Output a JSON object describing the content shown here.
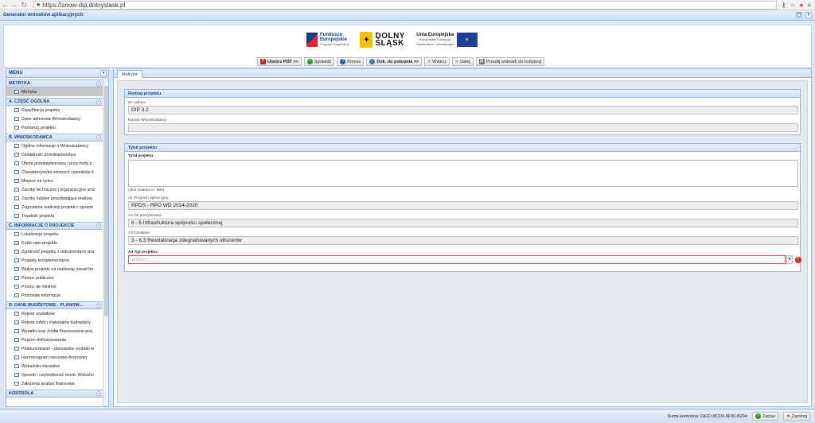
{
  "browser": {
    "url": "https://snow-dip.dolnyslask.pl"
  },
  "app": {
    "title": "Generator wniosków aplikacyjnych:"
  },
  "logos": {
    "fe_line1": "Fundusze",
    "fe_line2": "Europejskie",
    "fe_sub": "Program Regionalny",
    "ds_line1": "DOLNY",
    "ds_line2": "ŚLĄSK",
    "ue_title": "Unia Europejska",
    "ue_sub1": "Europejskie Fundusze",
    "ue_sub2": "Strukturalne i Inwestycyjne"
  },
  "toolbar": {
    "pdf": "Utwórz PDF >>",
    "check": "Sprawdź",
    "help": "Pomoc",
    "docs": "Dok. do pobrania >>",
    "back": "Wstecz",
    "next": "Dalej",
    "send": "Prześlij wniosek do Instytucji"
  },
  "sidebar": {
    "title": "MENU",
    "sections": [
      {
        "title": "METRYKA",
        "items": [
          "Metryka"
        ]
      },
      {
        "title": "A. CZĘŚĆ OGÓLNA",
        "items": [
          "Klasyfikacja projektu",
          "Dane adresowe Wnioskodawcy",
          "Partnerzy projektu"
        ]
      },
      {
        "title": "B. WNIOSKODAWCA",
        "items": [
          "Ogólne informacje o Wnioskodawcy",
          "Działalność przedsiębiorstwa",
          "Oferta przedsiębiorstwa i przychody z",
          "Charakterystyka istotnych czynników k",
          "Miejsce na rynku",
          "Zasoby techniczne i organizacyjne umo",
          "Zasoby ludzkie umożliwiające realizac",
          "Zagrożenia realizacji projektu i sposob",
          "Trwałość projektu"
        ]
      },
      {
        "title": "C. INFORMACJE O PROJEKCIE",
        "items": [
          "Lokalizacja projektu",
          "Krótki opis projektu",
          "Zgodność projektu z dokumentami stra",
          "Projekty komplementarne",
          "Wpływ projektu na realizację zasad ho",
          "Pomoc publiczna",
          "Pomoc de minimis",
          "Pozostałe informacje"
        ]
      },
      {
        "title": "D. DANE BUDŻETOWE - PLANOW...",
        "items": [
          "Rejestr wydatków",
          "Rejestr robót i materiałów budowlany",
          "Wydatki oraz źródła finansowania proj",
          "Poziom dofinansowania",
          "Podsumowanie - planowane wydatki w",
          "Harmonogram rzeczowo-finansowy",
          "Wskaźniki mierzalne",
          "Sposób i częstotliwość monit. Wskaźni",
          "Założenia analiza finansowa"
        ]
      },
      {
        "title": "KONTROLA",
        "items": []
      }
    ]
  },
  "main": {
    "tab": "Metryka",
    "rodzaj": {
      "title": "Rodzaj projektu",
      "nabor_label": "Nr naboru:",
      "nabor_value": "DIP 3.2",
      "wnioskodawca_label": "Nazwa Wnioskodawcy:",
      "wnioskodawca_value": ""
    },
    "tytul": {
      "title": "Tytuł projektu",
      "tytul_label": "Tytuł projektu:",
      "limit": "(limit znaków 0 / 500)",
      "a1_label": "A1 Program operacyjny:",
      "a1_value": "RPDS - RPO WD 2014-2020",
      "a2_label": "A2 Oś priorytetowa:",
      "a2_value": "6 - 6 Infrastruktura spójności społecznej",
      "a3_label": "A3 Działanie:",
      "a3_value": "3 - 6.3 Rewitalizacja zdegradowanych obszarów",
      "a4_label": "A4 Typ projektu:",
      "a4_placeholder": "Wybierz"
    }
  },
  "status": {
    "checksum": "Suma kontrolna: D41D-8CD9-8F00-B204",
    "save": "Zapisz",
    "close": "Zamknij"
  }
}
